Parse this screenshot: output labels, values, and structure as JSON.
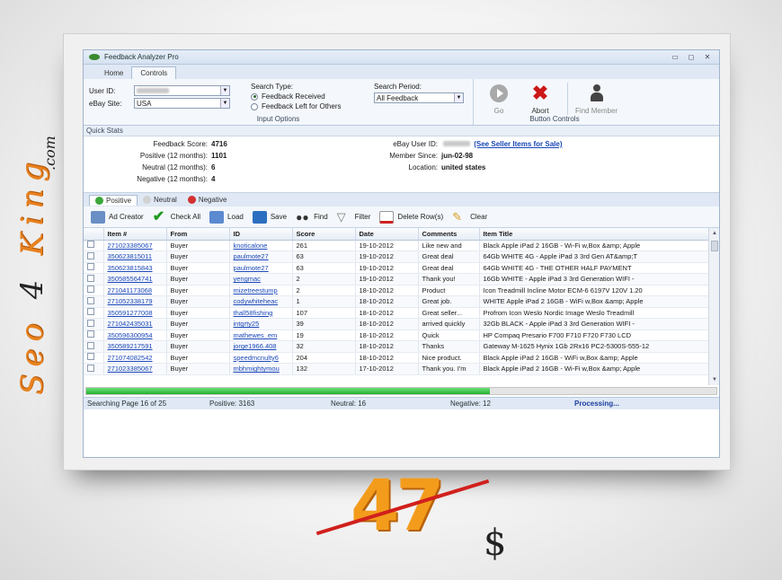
{
  "branding": {
    "vertical_text_a": "Seo",
    "vertical_text_4": "4",
    "vertical_text_b": "King",
    "dotcom": ".com"
  },
  "window": {
    "title": "Feedback Analyzer Pro",
    "btn_min": "▭",
    "btn_max": "◻",
    "btn_close": "✕"
  },
  "ribbon_tabs": [
    {
      "label": "Home"
    },
    {
      "label": "Controls"
    }
  ],
  "input_options": {
    "user_id_label": "User ID:",
    "ebay_site_label": "eBay Site:",
    "ebay_site_value": "USA",
    "search_type_label": "Search Type:",
    "radio_received": "Feedback Received",
    "radio_left": "Feedback Left for Others",
    "search_period_label": "Search Period:",
    "search_period_value": "All Feedback",
    "group_label": "Input Options"
  },
  "button_controls": {
    "go": "Go",
    "abort": "Abort",
    "find_member": "Find Member",
    "group_label": "Button Controls"
  },
  "quick_stats": {
    "title": "Quick Stats",
    "feedback_score_label": "Feedback Score:",
    "feedback_score": "4716",
    "positive_label": "Positive (12 months):",
    "positive": "1101",
    "neutral_label": "Neutral (12 months):",
    "neutral": "6",
    "negative_label": "Negative (12 months):",
    "negative": "4",
    "ebay_user_id_label": "eBay User ID:",
    "seller_link": "(See Seller Items for Sale)",
    "member_since_label": "Member Since:",
    "member_since": "jun-02-98",
    "location_label": "Location:",
    "location": "united states"
  },
  "subtabs": [
    {
      "label": "Positive",
      "color": "#3aa83a"
    },
    {
      "label": "Neutral",
      "color": "#bdbdbd"
    },
    {
      "label": "Negative",
      "color": "#d33030"
    }
  ],
  "toolbar": {
    "ad_creator": "Ad Creator",
    "check_all": "Check All",
    "load": "Load",
    "save": "Save",
    "find": "Find",
    "filter": "Filter",
    "delete_rows": "Delete Row(s)",
    "clear": "Clear"
  },
  "table": {
    "columns": [
      "Item #",
      "From",
      "ID",
      "Score",
      "Date",
      "Comments",
      "Item Title"
    ],
    "rows": [
      [
        "271023385067",
        "Buyer",
        "knoticalone",
        "261",
        "19-10-2012",
        "Like new and",
        "Black Apple iPad 2 16GB - Wi-Fi w,Box &amp; Apple"
      ],
      [
        "350623815011",
        "Buyer",
        "paulmote27",
        "63",
        "19-10-2012",
        "Great deal",
        "64Gb WHITE  4G - Apple iPad 3 3rd Gen AT&amp;T"
      ],
      [
        "350623815843",
        "Buyer",
        "paulmote27",
        "63",
        "19-10-2012",
        "Great deal",
        "64Gb WHITE  4G - THE OTHER HALF PAYMENT"
      ],
      [
        "350585564741",
        "Buyer",
        "yengmac",
        "2",
        "19-10-2012",
        "Thank you!",
        "16Gb WHITE - Apple iPad 3 3rd Generation WIFI -"
      ],
      [
        "271041173068",
        "Buyer",
        "mizetreestump",
        "2",
        "18-10-2012",
        "Product",
        "Icon Treadmill Incline Motor ECM-6 6197V 120V 1.20"
      ],
      [
        "271052338179",
        "Buyer",
        "codywhiteheac",
        "1",
        "18-10-2012",
        "Great job.",
        "WHITE Apple iPad 2 16GB - WiFi w,Box &amp; Apple"
      ],
      [
        "350591277008",
        "Buyer",
        "thall58fishing",
        "107",
        "18-10-2012",
        "Great seller...",
        "Profrom Icon Weslo Nordic Image Weslo Treadmill"
      ],
      [
        "271042435031",
        "Buyer",
        "intgrty25",
        "39",
        "18-10-2012",
        "arrived quickly",
        "32Gb BLACK - Apple iPad 3 3rd Generation WIFI -"
      ],
      [
        "350596300954",
        "Buyer",
        "mathewes_em",
        "19",
        "18-10-2012",
        "Quick",
        "HP Compaq Presario F700 F710 F720 F730 LCD"
      ],
      [
        "350589217591",
        "Buyer",
        "jorge1966.408",
        "32",
        "18-10-2012",
        "Thanks",
        "Gateway M-1625 Hynix 1Gb 2Rx16 PC2-5300S-555-12"
      ],
      [
        "271074082542",
        "Buyer",
        "speedmcnulty6",
        "204",
        "18-10-2012",
        "Nice product.",
        "Black Apple iPad 2 16GB - WiFi w,Box &amp; Apple"
      ],
      [
        "271023385067",
        "Buyer",
        "mbhmightymou",
        "132",
        "17-10-2012",
        "Thank you. I'm",
        "Black Apple iPad 2 16GB - Wi-Fi w,Box &amp; Apple"
      ]
    ]
  },
  "progress": {
    "fraction": 0.64
  },
  "status": {
    "searching": "Searching Page 16 of 25",
    "positive": "Positive: 3163",
    "neutral": "Neutral: 16",
    "negative": "Negative: 12",
    "processing": "Processing..."
  },
  "price": {
    "old": "47",
    "currency": "$"
  }
}
